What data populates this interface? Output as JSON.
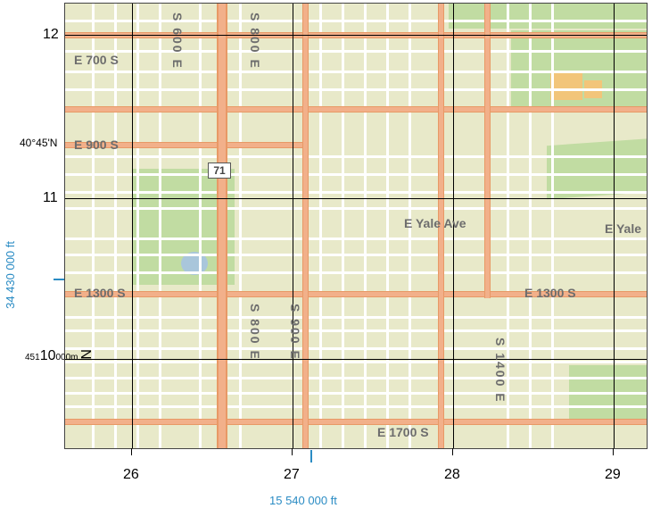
{
  "domain": "Map",
  "street_labels": {
    "e700s": "E 700 S",
    "e900s": "E 900 S",
    "e1300s_left": "E 1300 S",
    "e1300s_right": "E 1300 S",
    "e1700s": "E 1700 S",
    "s600e": "S 600 E",
    "s800e_top": "S 800 E",
    "s800e_bot": "S 800 E",
    "s900e": "S 900 E",
    "s1400e": "S 1400 E",
    "yale_left": "E Yale Ave",
    "yale_right": "E Yale"
  },
  "highway_shield": "71",
  "axis": {
    "y": {
      "ticks": [
        "12",
        "11"
      ],
      "utm_prefix": "451",
      "utm_main": "10",
      "utm_small_suffix": "000m",
      "orientation": "N",
      "lat_label": "40°45'N"
    },
    "x": {
      "ticks": [
        "26",
        "27",
        "28",
        "29"
      ]
    }
  },
  "state_plane": {
    "north": "34 430 000 ft",
    "east": "15 540 000 ft"
  }
}
